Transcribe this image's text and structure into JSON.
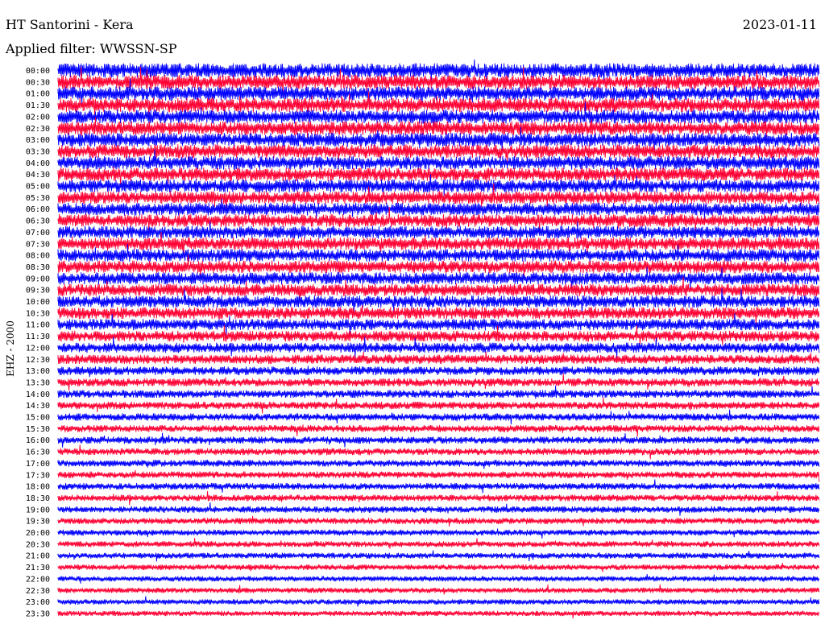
{
  "header": {
    "station": "HT Santorini - Kera",
    "date": "2023-01-11",
    "filter": "Applied filter: WWSSN-SP",
    "channel": "EHZ - 2000"
  },
  "colors": {
    "trace_a": "#0000ff",
    "trace_b": "#ff0033",
    "background": "#ffffff"
  },
  "chart_data": {
    "type": "helicorder",
    "title": "HT Santorini - Kera",
    "date": "2023-01-11",
    "filter": "WWSSN-SP",
    "channel": "EHZ - 2000",
    "line_duration_minutes": 30,
    "row_labels": [
      "00:00",
      "00:30",
      "01:00",
      "01:30",
      "02:00",
      "02:30",
      "03:00",
      "03:30",
      "04:00",
      "04:30",
      "05:00",
      "05:30",
      "06:00",
      "06:30",
      "07:00",
      "07:30",
      "08:00",
      "08:30",
      "09:00",
      "09:30",
      "10:00",
      "10:30",
      "11:00",
      "11:30",
      "12:00",
      "12:30",
      "13:00",
      "13:30",
      "14:00",
      "14:30",
      "15:00",
      "15:30",
      "16:00",
      "16:30",
      "17:00",
      "17:30",
      "18:00",
      "18:30",
      "19:00",
      "19:30",
      "20:00",
      "20:30",
      "21:00",
      "21:30",
      "22:00",
      "22:30",
      "23:00",
      "23:30"
    ],
    "series": [
      {
        "color": "#0000ff",
        "rows": "even (00:00, 01:00, ...)"
      },
      {
        "color": "#ff0033",
        "rows": "odd (00:30, 01:30, ...)"
      }
    ],
    "relative_amplitude": [
      1.0,
      1.0,
      0.98,
      0.98,
      0.96,
      0.96,
      0.95,
      0.95,
      0.93,
      0.93,
      0.9,
      0.88,
      0.86,
      0.86,
      0.84,
      0.84,
      0.84,
      0.84,
      0.82,
      0.82,
      0.8,
      0.78,
      0.72,
      0.68,
      0.62,
      0.55,
      0.5,
      0.45,
      0.42,
      0.4,
      0.38,
      0.36,
      0.36,
      0.34,
      0.33,
      0.32,
      0.32,
      0.3,
      0.3,
      0.28,
      0.26,
      0.25,
      0.24,
      0.22,
      0.2,
      0.2,
      0.19,
      0.18
    ]
  }
}
